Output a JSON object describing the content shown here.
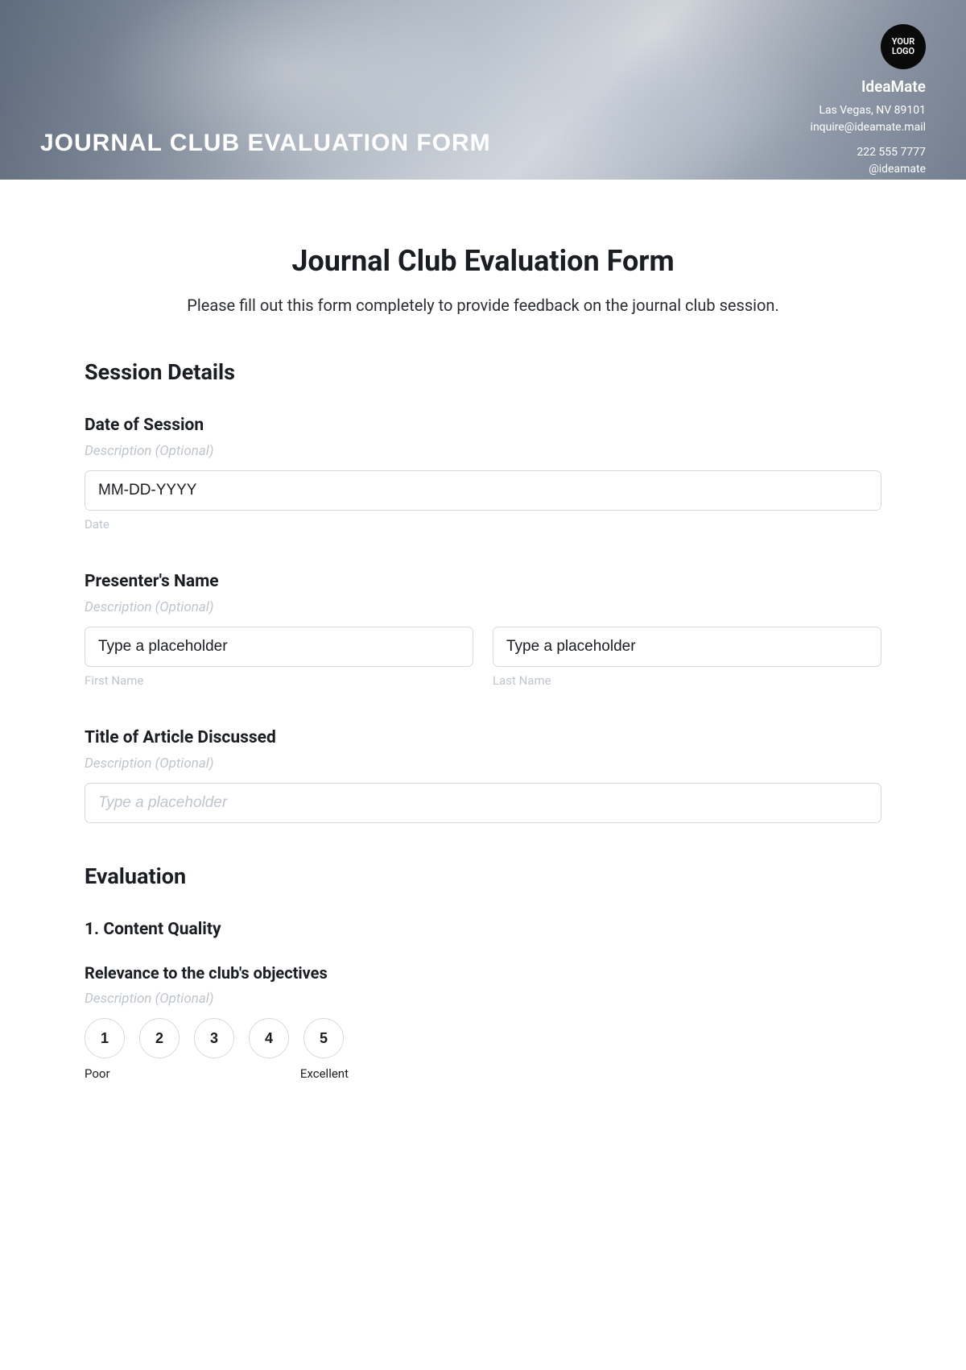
{
  "hero": {
    "title": "JOURNAL CLUB EVALUATION FORM",
    "logo_text": "YOUR LOGO",
    "company": "IdeaMate",
    "address": "Las Vegas, NV 89101",
    "email": "inquire@ideamate.mail",
    "phone": "222 555 7777",
    "handle": "@ideamate"
  },
  "form": {
    "title": "Journal Club Evaluation Form",
    "subtitle": "Please fill out this form completely to provide feedback on the journal club session."
  },
  "session": {
    "heading": "Session Details",
    "date_label": "Date of Session",
    "date_desc": "Description (Optional)",
    "date_placeholder": "MM-DD-YYYY",
    "date_sub": "Date",
    "presenter_label": "Presenter's Name",
    "presenter_desc": "Description (Optional)",
    "first_placeholder": "Type a placeholder",
    "first_sub": "First Name",
    "last_placeholder": "Type a placeholder",
    "last_sub": "Last Name",
    "title_label": "Title of Article Discussed",
    "title_desc": "Description (Optional)",
    "title_placeholder": "Type a placeholder"
  },
  "evaluation": {
    "heading": "Evaluation",
    "q1_heading": "1. Content Quality",
    "q1_label": "Relevance to the club's objectives",
    "q1_desc": "Description (Optional)",
    "ratings": [
      "1",
      "2",
      "3",
      "4",
      "5"
    ],
    "low": "Poor",
    "high": "Excellent"
  }
}
